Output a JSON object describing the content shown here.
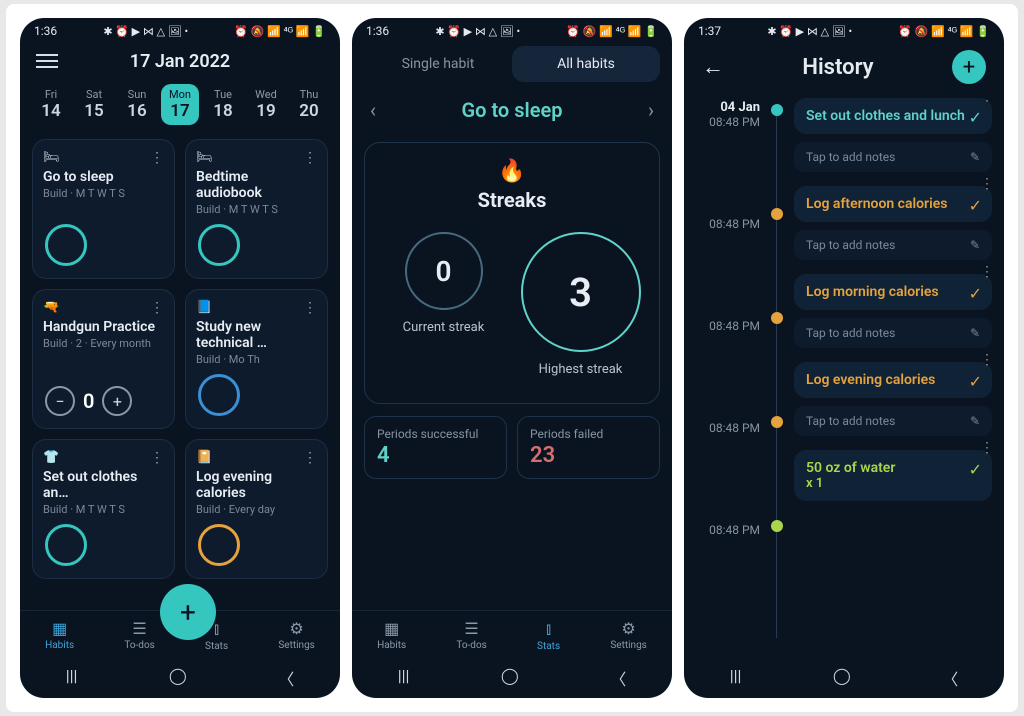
{
  "statusbar": {
    "time1": "1:36",
    "time2": "1:36",
    "time3": "1:37",
    "icons_left": "✱ ⏰ ▶ ⋈ △ 🖼 •",
    "icons_right": "⏰ 🔕 📶 ⁴ᴳ 📶 🔋"
  },
  "p1": {
    "title": "17 Jan 2022",
    "days": [
      {
        "name": "Fri",
        "num": "14"
      },
      {
        "name": "Sat",
        "num": "15"
      },
      {
        "name": "Sun",
        "num": "16"
      },
      {
        "name": "Mon",
        "num": "17",
        "active": true
      },
      {
        "name": "Tue",
        "num": "18"
      },
      {
        "name": "Wed",
        "num": "19"
      },
      {
        "name": "Thu",
        "num": "20"
      }
    ],
    "cards": [
      {
        "emoji": "🛏",
        "name": "Go to sleep",
        "meta": "Build · M T W T S",
        "ring": "teal"
      },
      {
        "emoji": "🛏",
        "name": "Bedtime audiobook",
        "meta": "Build · M T W T S",
        "ring": "teal"
      },
      {
        "emoji": "🔫",
        "name": "Handgun Practice",
        "meta": "Build · 2 · Every month",
        "stepper": true,
        "val": "0"
      },
      {
        "emoji": "📘",
        "name": "Study new technical …",
        "meta": "Build · Mo Th",
        "ring": "blue"
      },
      {
        "emoji": "👕",
        "name": "Set out clothes an…",
        "meta": "Build · M T W T S",
        "ring": "teal"
      },
      {
        "emoji": "📔",
        "name": "Log evening calories",
        "meta": "Build · Every day",
        "ring": "orange"
      }
    ],
    "nav": [
      "Habits",
      "To-dos",
      "Stats",
      "Settings"
    ],
    "navicons": [
      "▦",
      "☰",
      "⫾",
      "⚙"
    ]
  },
  "p2": {
    "tabs": [
      "Single habit",
      "All habits"
    ],
    "habit": "Go to sleep",
    "streaks_title": "Streaks",
    "current": "0",
    "highest": "3",
    "current_lbl": "Current streak",
    "highest_lbl": "Highest streak",
    "success_lbl": "Periods successful",
    "success_val": "4",
    "fail_lbl": "Periods failed",
    "fail_val": "23",
    "nav": [
      "Habits",
      "To-dos",
      "Stats",
      "Settings"
    ],
    "navicons": [
      "▦",
      "☰",
      "⫾",
      "⚙"
    ]
  },
  "p3": {
    "title": "History",
    "date": "04 Jan",
    "entries": [
      {
        "time": "08:48 PM",
        "name": "Set out clothes and lunch",
        "color": "teal",
        "dot": "#36c6c0"
      },
      {
        "time": "08:48 PM",
        "name": "Log afternoon calories",
        "color": "orange",
        "dot": "#e6a23c"
      },
      {
        "time": "08:48 PM",
        "name": "Log morning calories",
        "color": "orange",
        "dot": "#e6a23c"
      },
      {
        "time": "08:48 PM",
        "name": "Log evening calories",
        "color": "orange",
        "dot": "#e6a23c"
      },
      {
        "time": "08:48 PM",
        "name": "50 oz of water",
        "sub": "x 1",
        "color": "lime",
        "dot": "#a8d64a"
      }
    ],
    "notes_ph": "Tap to add notes"
  }
}
